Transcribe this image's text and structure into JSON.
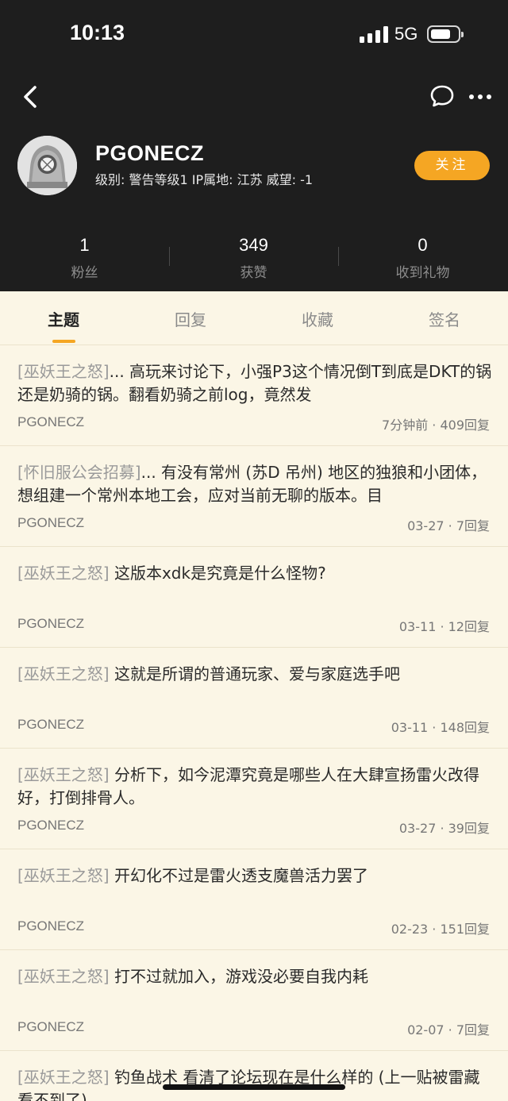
{
  "status_bar": {
    "time": "10:13",
    "network": "5G",
    "battery_level": 0.75
  },
  "profile": {
    "username": "PGONECZ",
    "meta": "级别: 警告等级1  IP属地: 江苏  威望: -1",
    "follow_label": "关注"
  },
  "stats": [
    {
      "value": "1",
      "label": "粉丝"
    },
    {
      "value": "349",
      "label": "获赞"
    },
    {
      "value": "0",
      "label": "收到礼物"
    }
  ],
  "tabs": [
    {
      "label": "主题",
      "active": true
    },
    {
      "label": "回复",
      "active": false
    },
    {
      "label": "收藏",
      "active": false
    },
    {
      "label": "签名",
      "active": false
    }
  ],
  "posts": [
    {
      "tag": "[巫妖王之怒]",
      "title": "... 高玩来讨论下，小强P3这个情况倒T到底是DKT的锅还是奶骑的锅。翻看奶骑之前log，竟然发",
      "author": "PGONECZ",
      "meta": "7分钟前 · 409回复"
    },
    {
      "tag": "[怀旧服公会招募]",
      "title": "... 有没有常州 (苏D 吊州) 地区的独狼和小团体，想组建一个常州本地工会，应对当前无聊的版本。目",
      "author": "PGONECZ",
      "meta": "03-27 · 7回复"
    },
    {
      "tag": "[巫妖王之怒]",
      "title": " 这版本xdk是究竟是什么怪物?",
      "author": "PGONECZ",
      "meta": "03-11 · 12回复"
    },
    {
      "tag": "[巫妖王之怒]",
      "title": " 这就是所谓的普通玩家、爱与家庭选手吧",
      "author": "PGONECZ",
      "meta": "03-11 · 148回复"
    },
    {
      "tag": "[巫妖王之怒]",
      "title": " 分析下，如今泥潭究竟是哪些人在大肆宣扬雷火改得好，打倒排骨人。",
      "author": "PGONECZ",
      "meta": "03-27 · 39回复"
    },
    {
      "tag": "[巫妖王之怒]",
      "title": " 开幻化不过是雷火透支魔兽活力罢了",
      "author": "PGONECZ",
      "meta": "02-23 · 151回复"
    },
    {
      "tag": "[巫妖王之怒]",
      "title": " 打不过就加入，游戏没必要自我内耗",
      "author": "PGONECZ",
      "meta": "02-07 · 7回复"
    },
    {
      "tag": "[巫妖王之怒]",
      "title": " 钓鱼战术 看清了论坛现在是什么样的 (上一贴被雷藏看不到了)",
      "author": "",
      "meta": ""
    }
  ]
}
